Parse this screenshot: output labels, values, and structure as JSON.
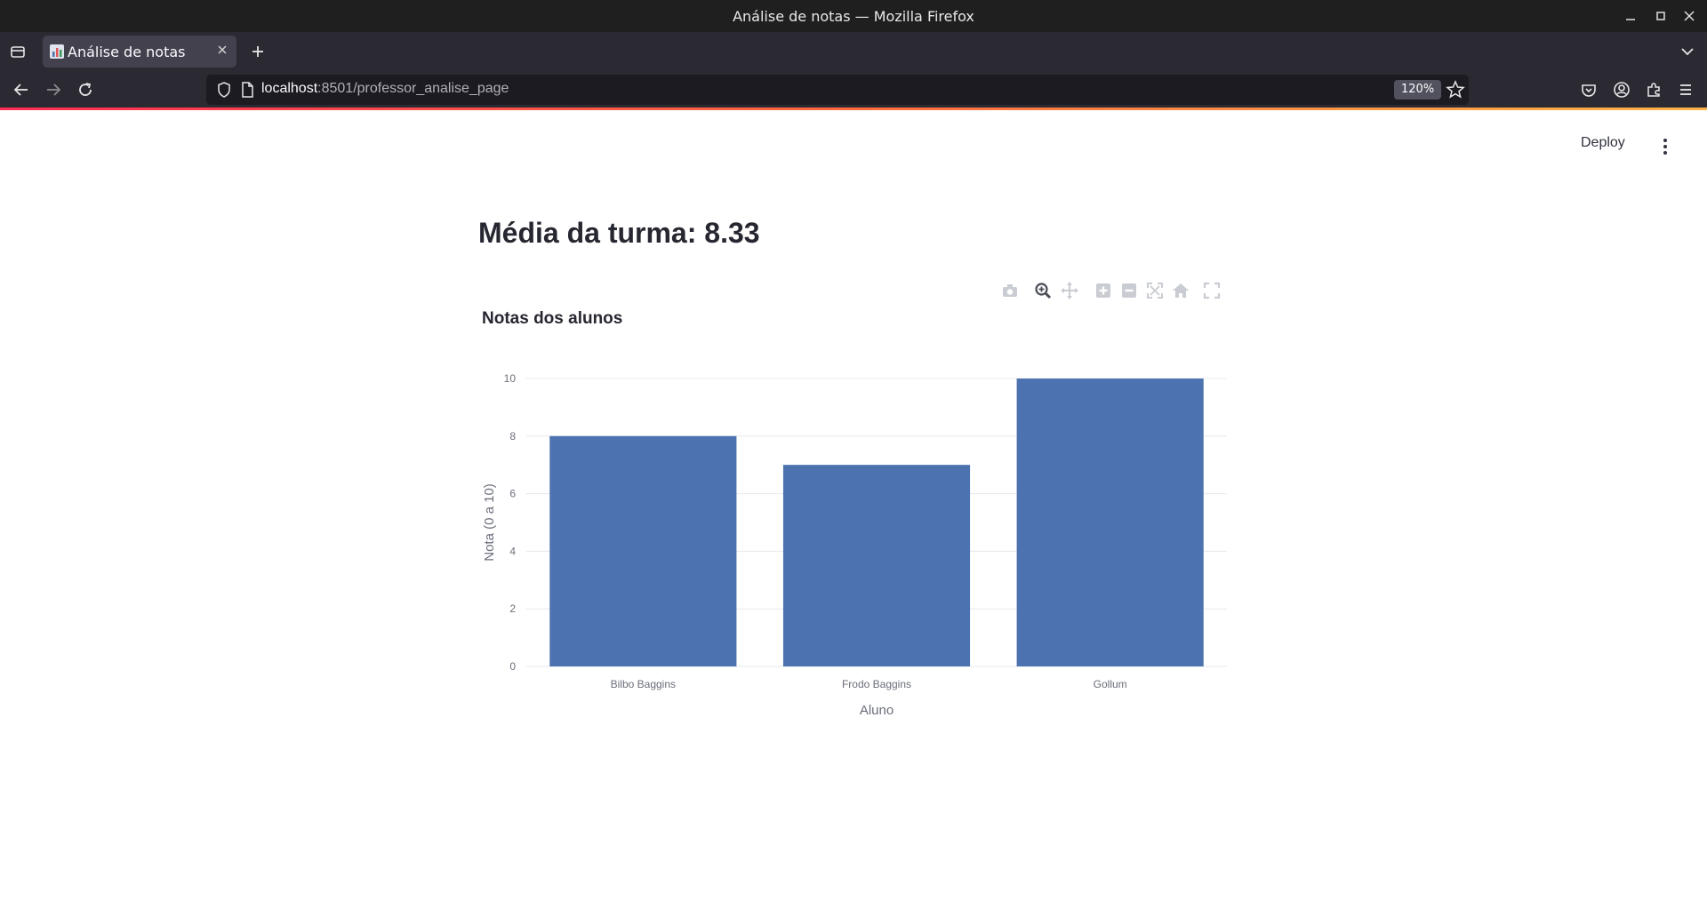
{
  "window": {
    "title": "Análise de notas — Mozilla Firefox"
  },
  "tab": {
    "label": "Análise de notas"
  },
  "url": {
    "host": "localhost",
    "rest": ":8501/professor_analise_page",
    "zoom": "120%"
  },
  "app": {
    "deploy_label": "Deploy",
    "heading": "Média da turma: 8.33"
  },
  "colors": {
    "bar": "#4c72b0",
    "grid": "#e6e8ec",
    "accent_gradient": [
      "#ff2d55",
      "#ffb347"
    ]
  },
  "chart_data": {
    "type": "bar",
    "title": "Notas dos alunos",
    "categories": [
      "Bilbo Baggins",
      "Frodo Baggins",
      "Gollum"
    ],
    "values": [
      8,
      7,
      10
    ],
    "xlabel": "Aluno",
    "ylabel": "Nota (0 a 10)",
    "ylim": [
      0,
      10
    ],
    "yticks": [
      0,
      2,
      4,
      6,
      8,
      10
    ],
    "grid": true
  }
}
